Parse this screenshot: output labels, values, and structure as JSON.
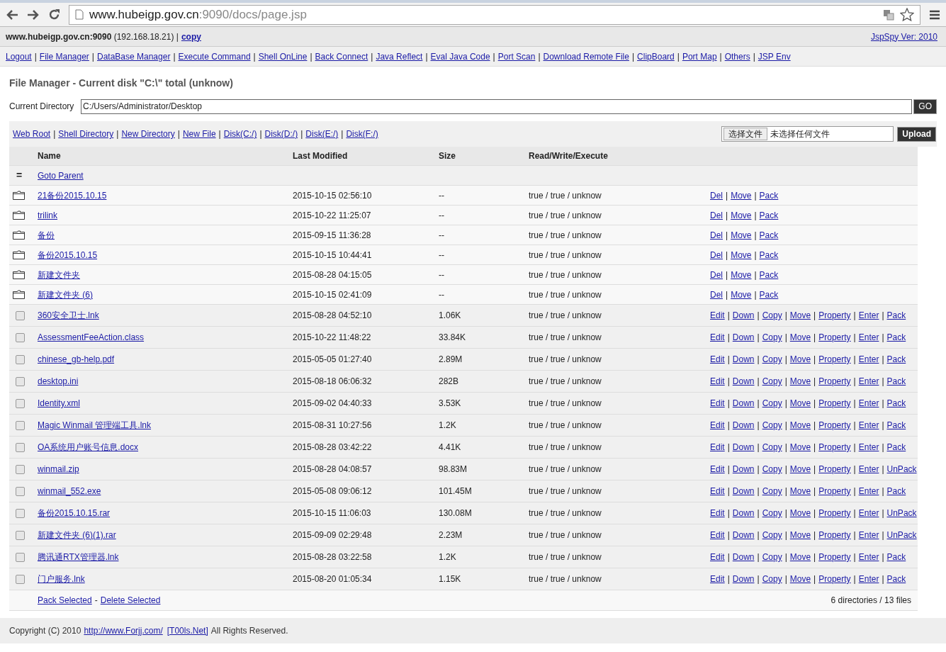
{
  "browser": {
    "url_host": "www.hubeigp.gov.cn",
    "url_path": ":9090/docs/page.jsp"
  },
  "info_bar": {
    "host": "**www.hubeigp.gov.cn:9090** (192.168.18.21) |",
    "copy_link": "copy",
    "version_link": "JspSpy Ver: 2010"
  },
  "link_separator": "|",
  "nav": [
    "Logout",
    "File Manager",
    "DataBase Manager",
    "Execute Command",
    "Shell OnLine",
    "Back Connect",
    "Java Reflect",
    "Eval Java Code",
    "Port Scan",
    "Download Remote File",
    "ClipBoard",
    "Port Map",
    "Others",
    "JSP Env"
  ],
  "page_title": "File Manager - Current disk \"C:\\\" total (unknow)",
  "current_directory": {
    "label": "Current Directory",
    "value": "C:/Users/Administrator/Desktop",
    "go_button": "GO"
  },
  "directory_links": [
    "Web Root",
    "Shell Directory",
    "New Directory",
    "New File",
    "Disk(C:/)",
    "Disk(D:/)",
    "Disk(E:/)",
    "Disk(F:/)"
  ],
  "upload": {
    "choose_button": "选择文件",
    "no_file_text": "未选择任何文件",
    "upload_button": "Upload"
  },
  "table": {
    "columns": [
      "Name",
      "Last Modified",
      "Size",
      "Read/Write/Execute"
    ],
    "parent_row": {
      "icon": "=",
      "link": "Goto Parent"
    },
    "rows": [
      {
        "kind": "directory",
        "name": "21备份2015.10.15",
        "modified": "2015-10-15 02:56:10",
        "size": "--",
        "rwe": "true / true / unknow",
        "actions": [
          "Del",
          "Move",
          "Pack"
        ]
      },
      {
        "kind": "directory",
        "name": "trilink",
        "modified": "2015-10-22 11:25:07",
        "size": "--",
        "rwe": "true / true / unknow",
        "actions": [
          "Del",
          "Move",
          "Pack"
        ]
      },
      {
        "kind": "directory",
        "name": "备份",
        "modified": "2015-09-15 11:36:28",
        "size": "--",
        "rwe": "true / true / unknow",
        "actions": [
          "Del",
          "Move",
          "Pack"
        ]
      },
      {
        "kind": "directory",
        "name": "备份2015.10.15",
        "modified": "2015-10-15 10:44:41",
        "size": "--",
        "rwe": "true / true / unknow",
        "actions": [
          "Del",
          "Move",
          "Pack"
        ]
      },
      {
        "kind": "directory",
        "name": "新建文件夹",
        "modified": "2015-08-28 04:15:05",
        "size": "--",
        "rwe": "true / true / unknow",
        "actions": [
          "Del",
          "Move",
          "Pack"
        ]
      },
      {
        "kind": "directory",
        "name": "新建文件夹 (6)",
        "modified": "2015-10-15 02:41:09",
        "size": "--",
        "rwe": "true / true / unknow",
        "actions": [
          "Del",
          "Move",
          "Pack"
        ]
      },
      {
        "kind": "file",
        "checked": false,
        "name": "360安全卫士.lnk",
        "modified": "2015-08-28 04:52:10",
        "size": "1.06K",
        "rwe": "true / true / unknow",
        "actions": [
          "Edit",
          "Down",
          "Copy",
          "Move",
          "Property",
          "Enter",
          "Pack"
        ]
      },
      {
        "kind": "file",
        "checked": false,
        "name": "AssessmentFeeAction.class",
        "modified": "2015-10-22 11:48:22",
        "size": "33.84K",
        "rwe": "true / true / unknow",
        "actions": [
          "Edit",
          "Down",
          "Copy",
          "Move",
          "Property",
          "Enter",
          "Pack"
        ]
      },
      {
        "kind": "file",
        "checked": false,
        "name": "chinese_gb-help.pdf",
        "modified": "2015-05-05 01:27:40",
        "size": "2.89M",
        "rwe": "true / true / unknow",
        "actions": [
          "Edit",
          "Down",
          "Copy",
          "Move",
          "Property",
          "Enter",
          "Pack"
        ]
      },
      {
        "kind": "file",
        "checked": false,
        "name": "desktop.ini",
        "modified": "2015-08-18 06:06:32",
        "size": "282B",
        "rwe": "true / true / unknow",
        "actions": [
          "Edit",
          "Down",
          "Copy",
          "Move",
          "Property",
          "Enter",
          "Pack"
        ]
      },
      {
        "kind": "file",
        "checked": false,
        "name": "Identity.xml",
        "modified": "2015-09-02 04:40:33",
        "size": "3.53K",
        "rwe": "true / true / unknow",
        "actions": [
          "Edit",
          "Down",
          "Copy",
          "Move",
          "Property",
          "Enter",
          "Pack"
        ]
      },
      {
        "kind": "file",
        "checked": false,
        "name": "Magic Winmail 管理端工具.lnk",
        "modified": "2015-08-31 10:27:56",
        "size": "1.2K",
        "rwe": "true / true / unknow",
        "actions": [
          "Edit",
          "Down",
          "Copy",
          "Move",
          "Property",
          "Enter",
          "Pack"
        ]
      },
      {
        "kind": "file",
        "checked": false,
        "name": "OA系统用户账号信息.docx",
        "modified": "2015-08-28 03:42:22",
        "size": "4.41K",
        "rwe": "true / true / unknow",
        "actions": [
          "Edit",
          "Down",
          "Copy",
          "Move",
          "Property",
          "Enter",
          "Pack"
        ]
      },
      {
        "kind": "file",
        "checked": false,
        "name": "winmail.zip",
        "modified": "2015-08-28 04:08:57",
        "size": "98.83M",
        "rwe": "true / true / unknow",
        "actions": [
          "Edit",
          "Down",
          "Copy",
          "Move",
          "Property",
          "Enter",
          "UnPack"
        ]
      },
      {
        "kind": "file",
        "checked": false,
        "name": "winmail_552.exe",
        "modified": "2015-05-08 09:06:12",
        "size": "101.45M",
        "rwe": "true / true / unknow",
        "actions": [
          "Edit",
          "Down",
          "Copy",
          "Move",
          "Property",
          "Enter",
          "Pack"
        ]
      },
      {
        "kind": "file",
        "checked": false,
        "name": "备份2015.10.15.rar",
        "modified": "2015-10-15 11:06:03",
        "size": "130.08M",
        "rwe": "true / true / unknow",
        "actions": [
          "Edit",
          "Down",
          "Copy",
          "Move",
          "Property",
          "Enter",
          "UnPack"
        ]
      },
      {
        "kind": "file",
        "checked": false,
        "name": "新建文件夹 (6)(1).rar",
        "modified": "2015-09-09 02:29:48",
        "size": "2.23M",
        "rwe": "true / true / unknow",
        "actions": [
          "Edit",
          "Down",
          "Copy",
          "Move",
          "Property",
          "Enter",
          "UnPack"
        ]
      },
      {
        "kind": "file",
        "checked": false,
        "name": "腾讯通RTX管理器.lnk",
        "modified": "2015-08-28 03:22:58",
        "size": "1.2K",
        "rwe": "true / true / unknow",
        "actions": [
          "Edit",
          "Down",
          "Copy",
          "Move",
          "Property",
          "Enter",
          "Pack"
        ]
      },
      {
        "kind": "file",
        "checked": false,
        "name": "门户服务.lnk",
        "modified": "2015-08-20 01:05:34",
        "size": "1.15K",
        "rwe": "true / true / unknow",
        "actions": [
          "Edit",
          "Down",
          "Copy",
          "Move",
          "Property",
          "Enter",
          "Pack"
        ]
      }
    ],
    "bulk": {
      "pack_link": "Pack Selected",
      "separator": "-",
      "delete_link": "Delete Selected"
    },
    "summary": "6 directories / 13 files"
  },
  "footer": {
    "prefix": "Copyright (C) 2010",
    "site_link": "http://www.Forjj.com/",
    "team_link": "[T00ls.Net]",
    "suffix": "All Rights Reserved."
  }
}
